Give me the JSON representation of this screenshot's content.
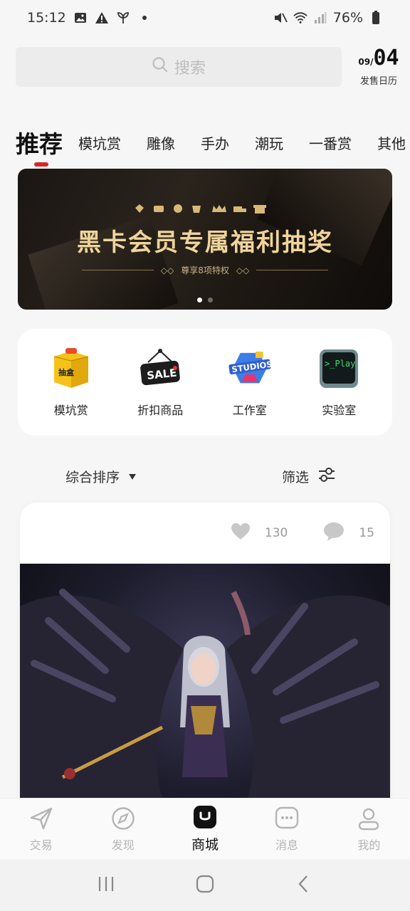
{
  "status_bar": {
    "time": "15:12",
    "battery": "76%"
  },
  "search": {
    "placeholder": "搜索"
  },
  "calendar": {
    "month": "09/",
    "day": "04",
    "label": "发售日历"
  },
  "tabs": [
    "推荐",
    "模坑赏",
    "雕像",
    "手办",
    "潮玩",
    "一番赏",
    "其他"
  ],
  "banner": {
    "title": "黑卡会员专属福利抽奖",
    "subtitle": "尊享8项特权"
  },
  "categories": [
    {
      "label": "模坑赏",
      "icon": "blind-box-icon"
    },
    {
      "label": "折扣商品",
      "icon": "sale-sign-icon"
    },
    {
      "label": "工作室",
      "icon": "studios-icon"
    },
    {
      "label": "实验室",
      "icon": "terminal-play-icon"
    }
  ],
  "categories_icon_text": {
    "sale": "SALE",
    "studios": "STUDIOS",
    "play": ">_Play",
    "box": "抽盒"
  },
  "sort": {
    "label": "综合排序",
    "filter_label": "筛选"
  },
  "card": {
    "likes": "130",
    "comments": "15"
  },
  "bottom_nav": [
    {
      "label": "交易",
      "icon": "paper-plane-icon"
    },
    {
      "label": "发现",
      "icon": "compass-icon"
    },
    {
      "label": "商城",
      "icon": "mall-icon"
    },
    {
      "label": "消息",
      "icon": "chat-icon"
    },
    {
      "label": "我的",
      "icon": "profile-icon"
    }
  ],
  "colors": {
    "accent": "#d8262c",
    "banner_gold": "#f0d49a"
  }
}
